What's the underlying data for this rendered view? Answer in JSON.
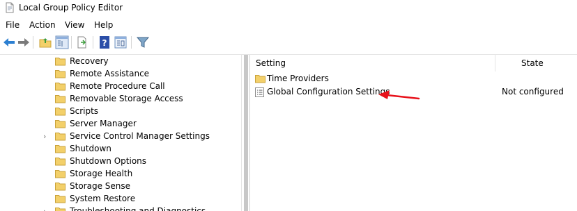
{
  "window": {
    "title": "Local Group Policy Editor"
  },
  "menu": {
    "items": [
      "File",
      "Action",
      "View",
      "Help"
    ]
  },
  "toolbar": {
    "buttons": [
      "back-icon",
      "forward-icon",
      "up-folder-icon",
      "show-hide-tree-icon",
      "export-list-icon",
      "help-icon",
      "properties-icon",
      "filter-icon"
    ]
  },
  "tree": {
    "items": [
      {
        "label": "Recovery",
        "expandable": false
      },
      {
        "label": "Remote Assistance",
        "expandable": false
      },
      {
        "label": "Remote Procedure Call",
        "expandable": false
      },
      {
        "label": "Removable Storage Access",
        "expandable": false
      },
      {
        "label": "Scripts",
        "expandable": false
      },
      {
        "label": "Server Manager",
        "expandable": false
      },
      {
        "label": "Service Control Manager Settings",
        "expandable": true
      },
      {
        "label": "Shutdown",
        "expandable": false
      },
      {
        "label": "Shutdown Options",
        "expandable": false
      },
      {
        "label": "Storage Health",
        "expandable": false
      },
      {
        "label": "Storage Sense",
        "expandable": false
      },
      {
        "label": "System Restore",
        "expandable": false
      },
      {
        "label": "Troubleshooting and Diagnostics",
        "expandable": true
      }
    ]
  },
  "list": {
    "columns": {
      "setting": "Setting",
      "state": "State"
    },
    "rows": [
      {
        "name": "Time Providers",
        "state": "",
        "icon": "folder-icon"
      },
      {
        "name": "Global Configuration Settings",
        "state": "Not configured",
        "icon": "policy-setting-icon"
      }
    ]
  },
  "annotation": {
    "color": "#e8121b",
    "target": "Global Configuration Settings"
  },
  "colors": {
    "folder": "#f3d06a",
    "folder_border": "#c9a23a",
    "nav_arrow": "#2c7fd1"
  }
}
